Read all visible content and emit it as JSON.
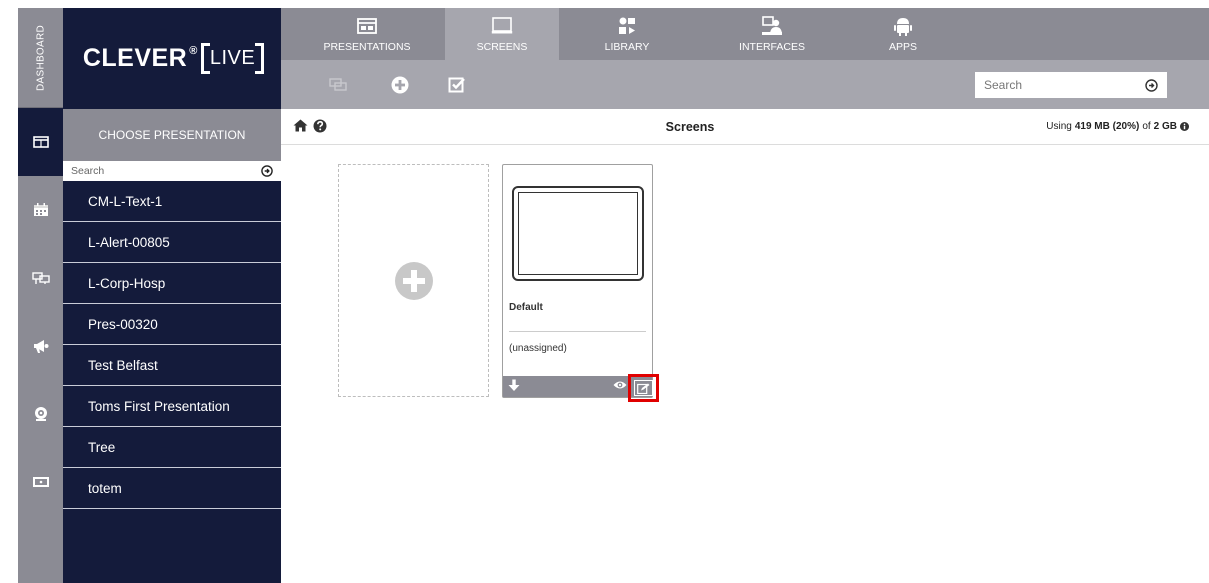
{
  "brand": {
    "name": "CLEVER",
    "reg": "®",
    "live": "LIVE"
  },
  "rail": {
    "dashboard_label": "DASHBOARD"
  },
  "nav": {
    "tabs": [
      {
        "label": "PRESENTATIONS",
        "icon": "presentation-icon"
      },
      {
        "label": "SCREENS",
        "icon": "monitor-icon",
        "active": true
      },
      {
        "label": "LIBRARY",
        "icon": "library-icon"
      },
      {
        "label": "INTERFACES",
        "icon": "interfaces-icon"
      },
      {
        "label": "APPS",
        "icon": "android-icon"
      }
    ]
  },
  "toolbar": {
    "search_placeholder": "Search"
  },
  "sidebar": {
    "choose_label": "CHOOSE PRESENTATION",
    "search_placeholder": "Search",
    "items": [
      "CM-L-Text-1",
      "L-Alert-00805",
      "L-Corp-Hosp",
      "Pres-00320",
      "Test Belfast",
      "Toms First Presentation",
      "Tree",
      "totem"
    ]
  },
  "content": {
    "title": "Screens",
    "usage_prefix": "Using",
    "usage_amount": "419 MB (20%)",
    "usage_of": "of",
    "usage_total": "2 GB"
  },
  "screen_card": {
    "name": "Default",
    "status": "(unassigned)"
  },
  "colors": {
    "navy": "#141b3b",
    "gray": "#8b8b94",
    "light_gray": "#a6a6ae",
    "highlight": "#e00000"
  }
}
